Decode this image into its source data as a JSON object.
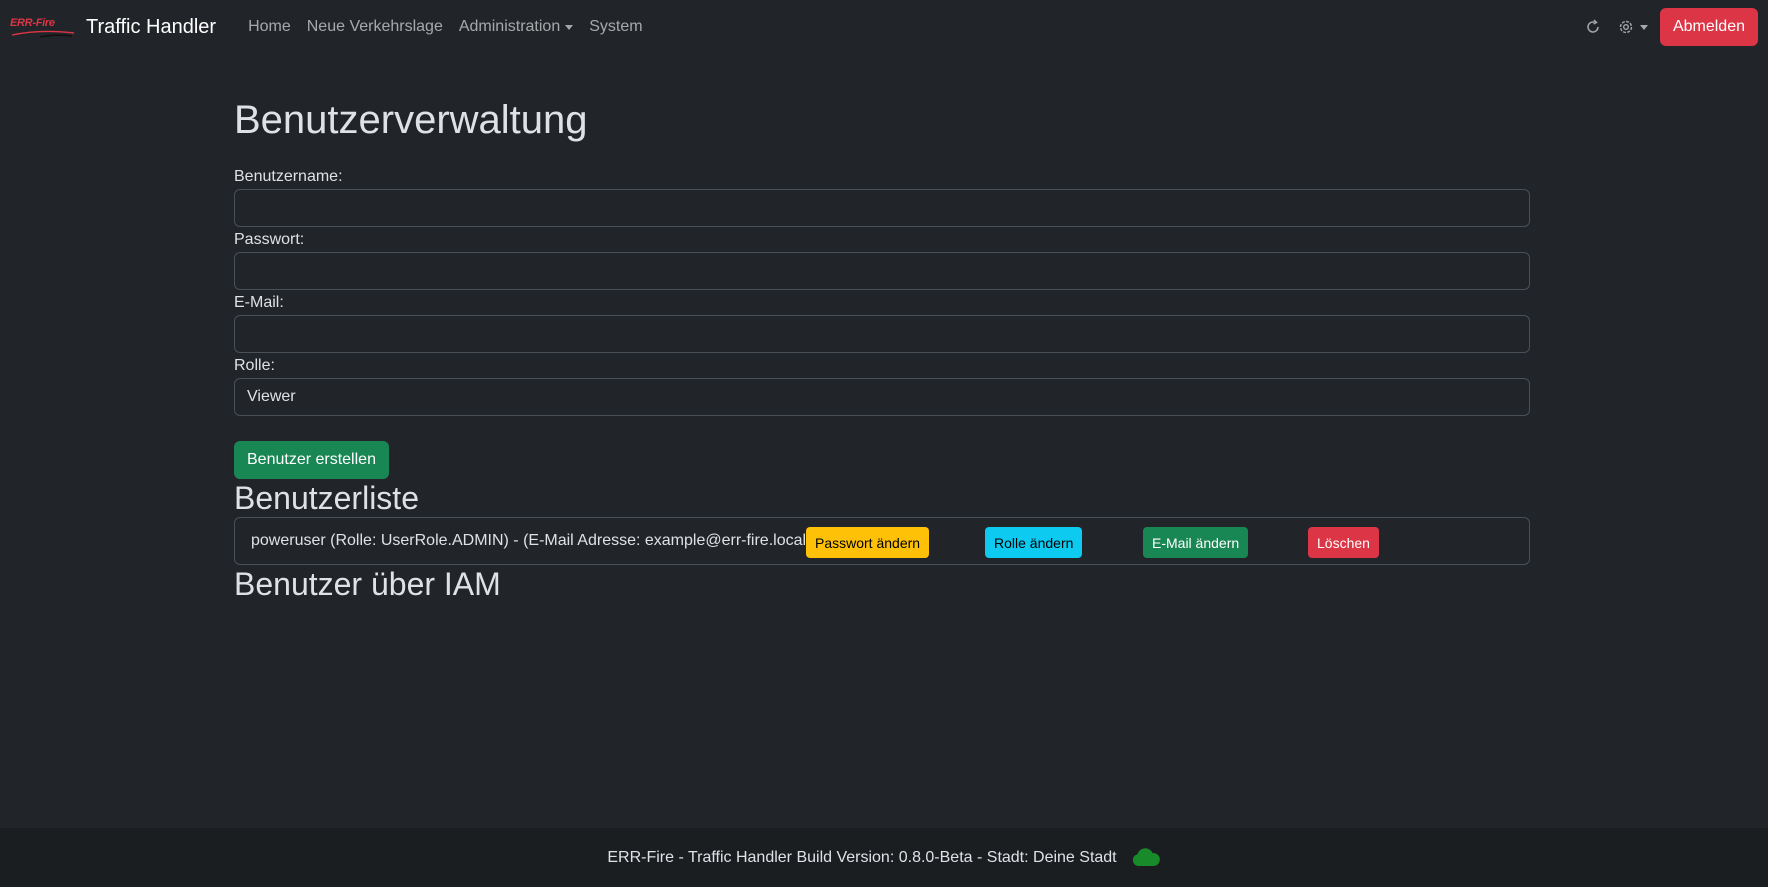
{
  "brand": {
    "logo_text": "ERR-Fire",
    "title": "Traffic Handler"
  },
  "nav": {
    "items": [
      {
        "label": "Home"
      },
      {
        "label": "Neue Verkehrslage"
      },
      {
        "label": "Administration"
      },
      {
        "label": "System"
      }
    ],
    "logout_label": "Abmelden"
  },
  "icons": {
    "refresh": "refresh-icon",
    "settings": "gear-icon",
    "status": "cloud-icon"
  },
  "colors": {
    "background": "#212529",
    "danger": "#dc3545",
    "success": "#198754",
    "warning": "#ffc107",
    "info": "#0dcaf0",
    "status_cloud": "#198a2a"
  },
  "page": {
    "title": "Benutzerverwaltung"
  },
  "form": {
    "username_label": "Benutzername:",
    "username_value": "",
    "password_label": "Passwort:",
    "password_value": "",
    "email_label": "E-Mail:",
    "email_value": "",
    "role_label": "Rolle:",
    "role_value": "Viewer",
    "create_button": "Benutzer erstellen"
  },
  "user_list": {
    "title": "Benutzerliste",
    "users": [
      {
        "text": "poweruser (Rolle: UserRole.ADMIN) - (E-Mail Adresse: example@err-fire.local)",
        "change_password": "Passwort ändern",
        "change_role": "Rolle ändern",
        "change_email": "E-Mail ändern",
        "delete": "Löschen"
      }
    ]
  },
  "iam": {
    "title": "Benutzer über IAM"
  },
  "footer": {
    "text": "ERR-Fire - Traffic Handler Build Version: 0.8.0-Beta - Stadt: Deine Stadt"
  }
}
